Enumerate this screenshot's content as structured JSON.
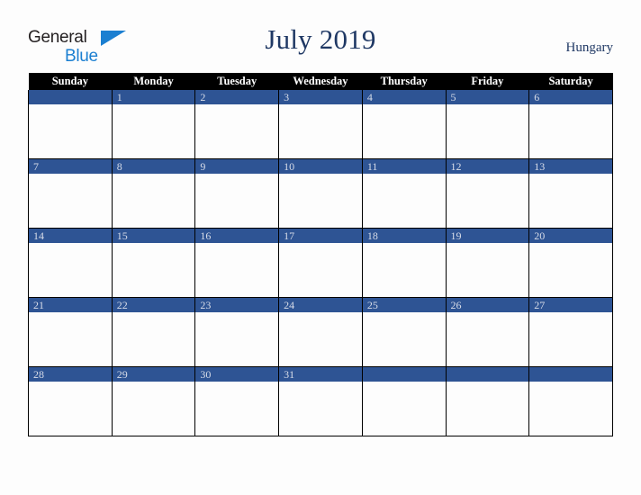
{
  "brand": {
    "name_part1": "General",
    "name_part2": "Blue",
    "triangle_icon": "triangle-icon",
    "color_dark": "#231F20",
    "color_blue": "#1B7FD1"
  },
  "header": {
    "title": "July 2019",
    "country": "Hungary",
    "title_color": "#1F3864"
  },
  "calendar": {
    "weekday_headers": [
      "Sunday",
      "Monday",
      "Tuesday",
      "Wednesday",
      "Thursday",
      "Friday",
      "Saturday"
    ],
    "header_bg": "#000000",
    "header_text": "#FFFFFF",
    "daybar_bg": "#2E5494",
    "daybar_text": "#D7DCE8",
    "cell_bg": "#FDFDFD",
    "grid_line": "#000000",
    "weeks": [
      {
        "days": [
          {
            "num": ""
          },
          {
            "num": "1"
          },
          {
            "num": "2"
          },
          {
            "num": "3"
          },
          {
            "num": "4"
          },
          {
            "num": "5"
          },
          {
            "num": "6"
          }
        ]
      },
      {
        "days": [
          {
            "num": "7"
          },
          {
            "num": "8"
          },
          {
            "num": "9"
          },
          {
            "num": "10"
          },
          {
            "num": "11"
          },
          {
            "num": "12"
          },
          {
            "num": "13"
          }
        ]
      },
      {
        "days": [
          {
            "num": "14"
          },
          {
            "num": "15"
          },
          {
            "num": "16"
          },
          {
            "num": "17"
          },
          {
            "num": "18"
          },
          {
            "num": "19"
          },
          {
            "num": "20"
          }
        ]
      },
      {
        "days": [
          {
            "num": "21"
          },
          {
            "num": "22"
          },
          {
            "num": "23"
          },
          {
            "num": "24"
          },
          {
            "num": "25"
          },
          {
            "num": "26"
          },
          {
            "num": "27"
          }
        ]
      },
      {
        "days": [
          {
            "num": "28"
          },
          {
            "num": "29"
          },
          {
            "num": "30"
          },
          {
            "num": "31"
          },
          {
            "num": ""
          },
          {
            "num": ""
          },
          {
            "num": ""
          }
        ]
      }
    ]
  }
}
